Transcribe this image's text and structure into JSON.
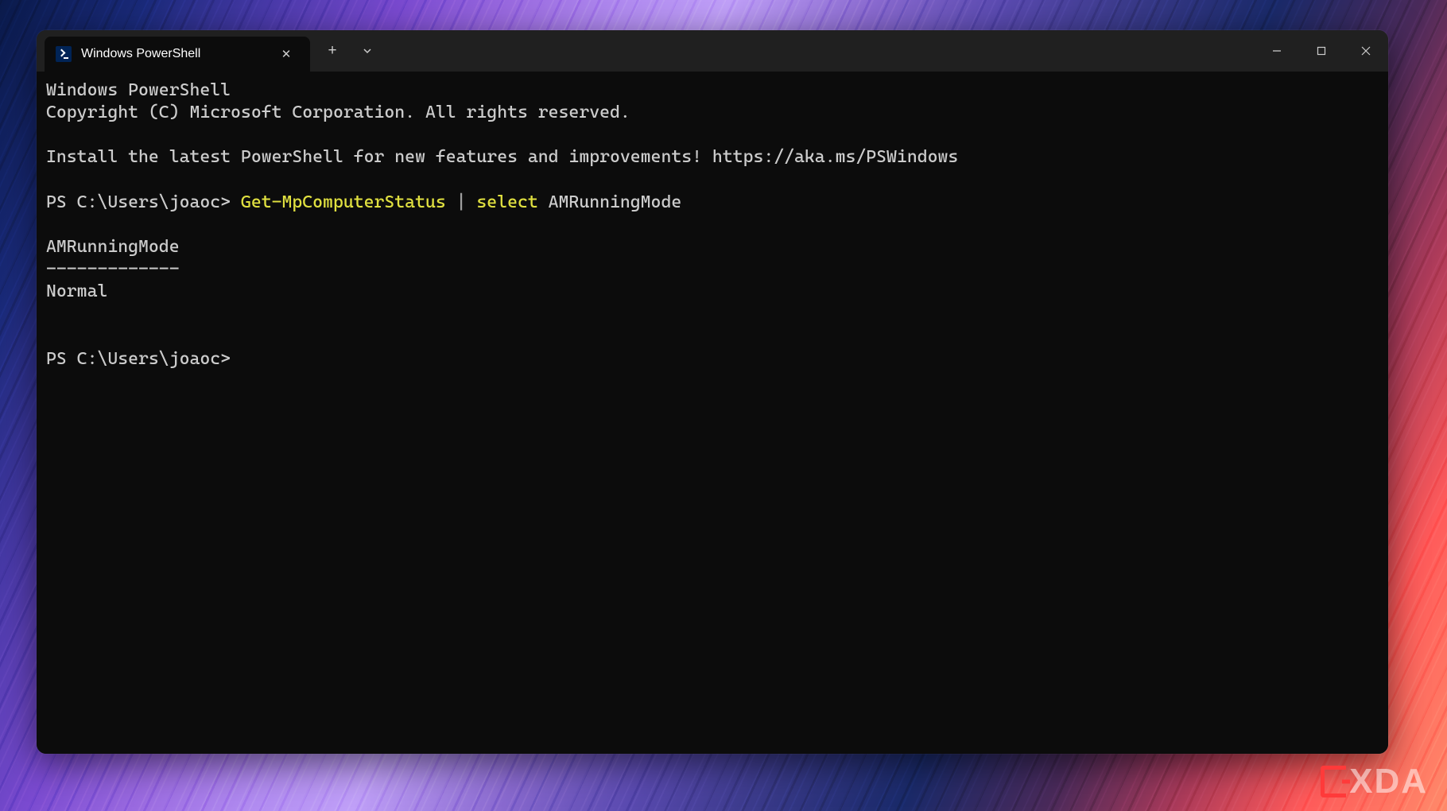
{
  "window": {
    "tab_title": "Windows PowerShell",
    "tab_icon": "powershell-icon",
    "new_tab": "+",
    "dropdown": "⌄",
    "minimize": "—",
    "maximize": "□",
    "close": "✕",
    "tab_close": "✕"
  },
  "terminal": {
    "line1": "Windows PowerShell",
    "line2": "Copyright (C) Microsoft Corporation. All rights reserved.",
    "blank1": "",
    "line3": "Install the latest PowerShell for new features and improvements! https://aka.ms/PSWindows",
    "blank2": "",
    "prompt1_prefix": "PS C:\\Users\\joaoc> ",
    "cmd_part1": "Get-MpComputerStatus",
    "cmd_pipe": " | ",
    "cmd_part2": "select",
    "cmd_arg": " AMRunningMode",
    "blank3": "",
    "out_header": "AMRunningMode",
    "out_divider": "-------------",
    "out_value": "Normal",
    "blank4": "",
    "blank5": "",
    "prompt2": "PS C:\\Users\\joaoc>"
  },
  "watermark": {
    "text": "XDA"
  }
}
